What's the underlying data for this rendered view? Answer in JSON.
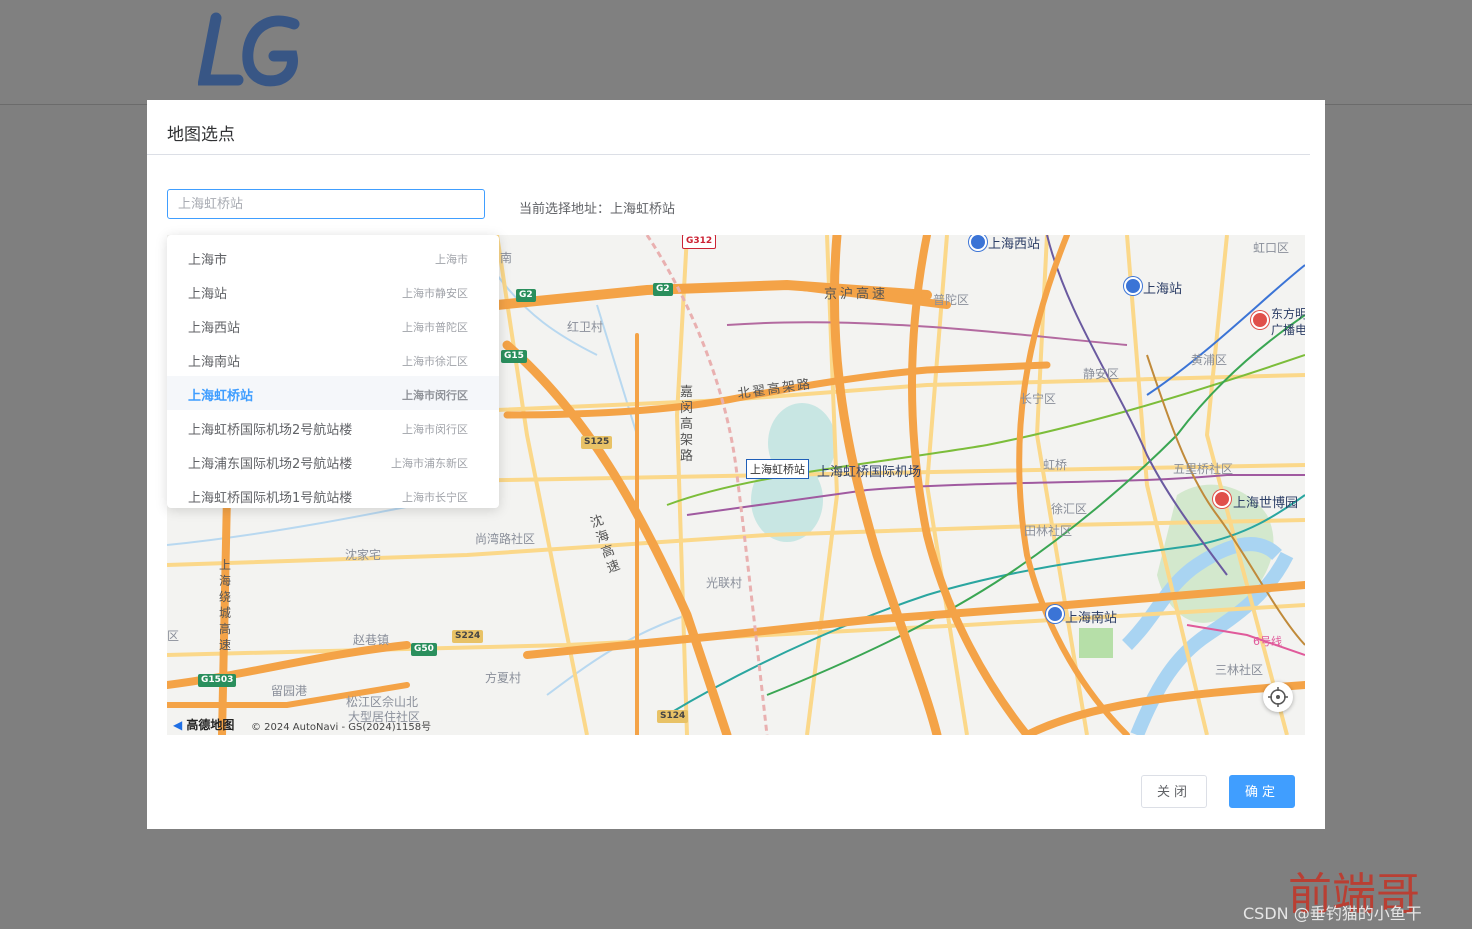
{
  "dialog": {
    "title": "地图选点",
    "search_placeholder": "上海虹桥站",
    "current_address_label": "当前选择地址：上海虹桥站",
    "close_button": "关闭",
    "confirm_button": "确定"
  },
  "dropdown": [
    {
      "name": "上海市",
      "district": "上海市",
      "active": false
    },
    {
      "name": "上海站",
      "district": "上海市静安区",
      "active": false
    },
    {
      "name": "上海西站",
      "district": "上海市普陀区",
      "active": false
    },
    {
      "name": "上海南站",
      "district": "上海市徐汇区",
      "active": false
    },
    {
      "name": "上海虹桥站",
      "district": "上海市闵行区",
      "active": true
    },
    {
      "name": "上海虹桥国际机场2号航站楼",
      "district": "上海市闵行区",
      "active": false
    },
    {
      "name": "上海浦东国际机场2号航站楼",
      "district": "上海市浦东新区",
      "active": false
    },
    {
      "name": "上海虹桥国际机场1号航站楼",
      "district": "上海市长宁区",
      "active": false
    }
  ],
  "map": {
    "marker_label": "上海虹桥站",
    "pois": {
      "shanghai_west": "上海西站",
      "shanghai_station": "上海站",
      "shanghai_south": "上海南站",
      "airport": "上海虹桥国际机场",
      "expo": "上海世博园",
      "oriental": "东方明",
      "oriental2": "广播电"
    },
    "districts": {
      "hongkou": "虹口区",
      "putuo": "普陀区",
      "jingan": "静安区",
      "huangpu": "黄浦区",
      "changning": "长宁区",
      "xuhui": "徐汇区",
      "tianlin": "田林社区",
      "wulijiao": "五里桥社区",
      "sanlin": "三林社区",
      "hongqiao": "虹桥",
      "hongwei": "红卫村",
      "shangwan": "尚湾路社区",
      "shenjia": "沈家宅",
      "zhaoxiang": "赵巷镇",
      "fangxia": "方夏村",
      "guanglian": "光联村",
      "songjiang": "松江区佘山北",
      "daxing": "大型居住社区",
      "lubo": "留园港",
      "qu": "区",
      "nan": "南",
      "line6": "6号线"
    },
    "roads": {
      "jinghu": "京沪高速",
      "beizhai": "北翟高架路",
      "jiamin": "嘉闵高架路",
      "shenhai": "沈海高速",
      "raocheng": "上海绕城高速"
    },
    "shields": {
      "g2a": "G2",
      "g2b": "G2",
      "g15": "G15",
      "s125": "S125",
      "s224": "S224",
      "g50": "G50",
      "g1503": "G1503",
      "s124": "S124",
      "g312": "G312"
    },
    "attribution": {
      "logo": "高德地图",
      "copyright": "© 2024 AutoNavi - GS(2024)1158号"
    }
  },
  "watermark": {
    "big": "前端哥",
    "small": "CSDN @垂钓猫的小鱼干"
  }
}
